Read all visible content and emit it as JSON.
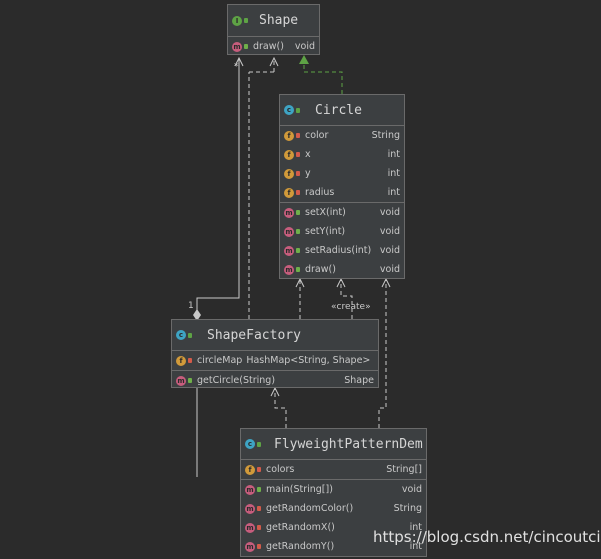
{
  "classes": {
    "shape": {
      "name": "Shape",
      "methods": [
        {
          "name": "draw()",
          "type": "void"
        }
      ]
    },
    "circle": {
      "name": "Circle",
      "fields": [
        {
          "name": "color",
          "type": "String"
        },
        {
          "name": "x",
          "type": "int"
        },
        {
          "name": "y",
          "type": "int"
        },
        {
          "name": "radius",
          "type": "int"
        }
      ],
      "methods": [
        {
          "name": "setX(int)",
          "type": "void"
        },
        {
          "name": "setY(int)",
          "type": "void"
        },
        {
          "name": "setRadius(int)",
          "type": "void"
        },
        {
          "name": "draw()",
          "type": "void"
        }
      ]
    },
    "factory": {
      "name": "ShapeFactory",
      "fields": [
        {
          "name": "circleMap",
          "type": "HashMap<String, Shape>"
        }
      ],
      "methods": [
        {
          "name": "getCircle(String)",
          "type": "Shape"
        }
      ]
    },
    "demo": {
      "name": "FlyweightPatternDem",
      "fields": [
        {
          "name": "colors",
          "type": "String[]"
        }
      ],
      "methods": [
        {
          "name": "main(String[])",
          "type": "void"
        },
        {
          "name": "getRandomColor()",
          "type": "String"
        },
        {
          "name": "getRandomX()",
          "type": "int"
        },
        {
          "name": "getRandomY()",
          "type": "int"
        }
      ]
    }
  },
  "labels": {
    "create": "«create»",
    "multiplicity_many": "*",
    "multiplicity_one": "1"
  },
  "colors": {
    "background": "#2b2b2b",
    "box": "#3c3f41",
    "border": "#6a6a6a",
    "realization_arrow": "#5ea345",
    "edge": "#c9c9c9"
  },
  "watermark": "https://blog.csdn.net/cincoutcin"
}
